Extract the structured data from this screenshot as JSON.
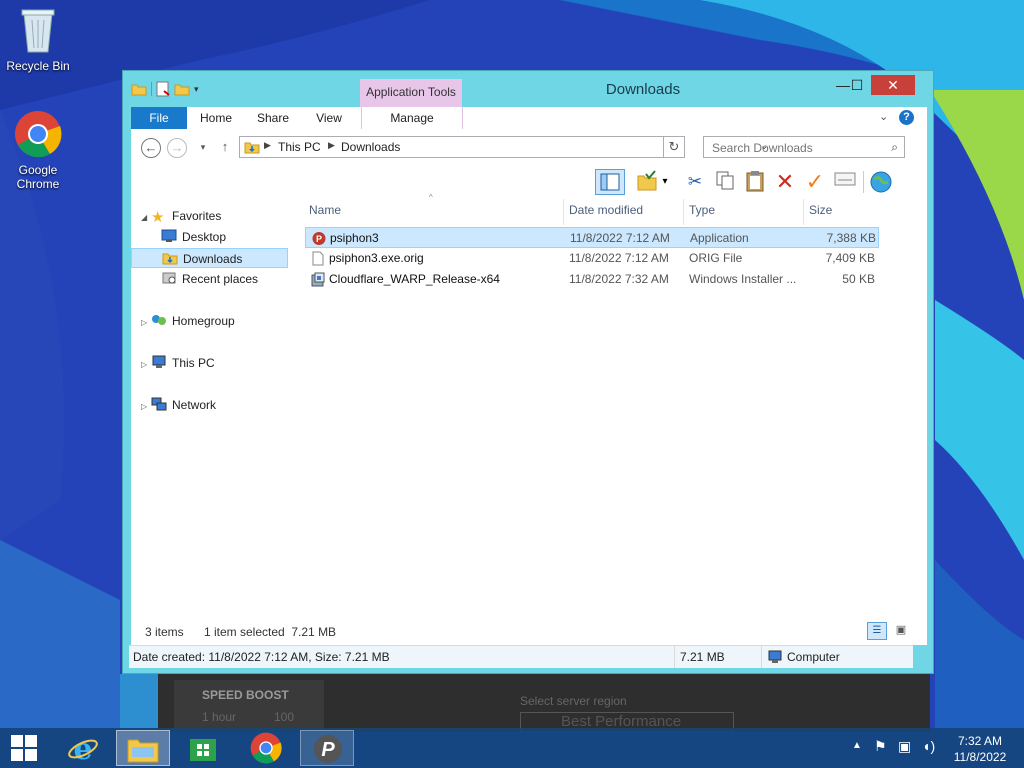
{
  "desktop": {
    "icons": [
      {
        "label": "Recycle Bin"
      },
      {
        "label": "Google Chrome"
      }
    ]
  },
  "background_app": {
    "speed_boost": "SPEED BOOST",
    "hour_label": "1 hour",
    "points": "100",
    "region_label": "Select server region",
    "region_value": "Best Performance"
  },
  "window": {
    "title": "Downloads",
    "app_tools": "Application Tools",
    "controls": {
      "minimize": "—",
      "maximize": "☐",
      "close": "✕"
    }
  },
  "ribbon": {
    "tabs": [
      {
        "label": "File"
      },
      {
        "label": "Home"
      },
      {
        "label": "Share"
      },
      {
        "label": "View"
      },
      {
        "label": "Manage"
      }
    ]
  },
  "address": {
    "crumbs": [
      "This PC",
      "Downloads"
    ],
    "search_placeholder": "Search Downloads"
  },
  "nav_pane": {
    "favorites": "Favorites",
    "desktop": "Desktop",
    "downloads": "Downloads",
    "recent": "Recent places",
    "homegroup": "Homegroup",
    "this_pc": "This PC",
    "network": "Network"
  },
  "columns": {
    "name": "Name",
    "date": "Date modified",
    "type": "Type",
    "size": "Size"
  },
  "files": [
    {
      "name": "psiphon3",
      "date": "11/8/2022 7:12 AM",
      "type": "Application",
      "size": "7,388 KB",
      "selected": true
    },
    {
      "name": "psiphon3.exe.orig",
      "date": "11/8/2022 7:12 AM",
      "type": "ORIG File",
      "size": "7,409 KB",
      "selected": false
    },
    {
      "name": "Cloudflare_WARP_Release-x64",
      "date": "11/8/2022 7:32 AM",
      "type": "Windows Installer ...",
      "size": "50 KB",
      "selected": false
    }
  ],
  "status": {
    "count": "3 items",
    "selection": "1 item selected  7.21 MB"
  },
  "details": {
    "created": "Date created: 11/8/2022 7:12 AM, Size: 7.21 MB",
    "size": "7.21 MB",
    "location": "Computer"
  },
  "taskbar": {
    "time": "7:32 AM",
    "date": "11/8/2022"
  },
  "colors": {
    "window_frame": "#6fd6e6",
    "file_tab": "#1979ca",
    "app_tools_tab": "#e8c6e9",
    "selection": "#cce8ff",
    "close_button": "#c7403a"
  }
}
